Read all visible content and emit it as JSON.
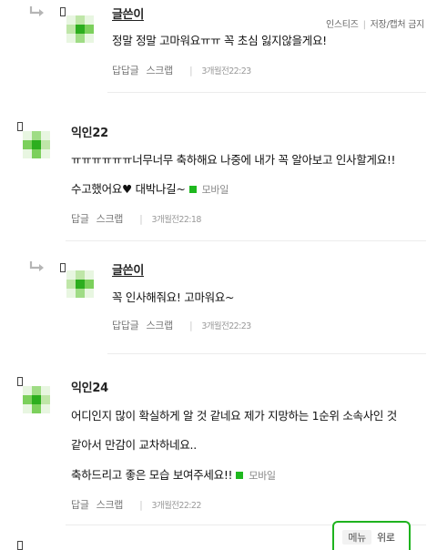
{
  "watermark": {
    "left": "인스티즈",
    "right": "저장/캡처 금지"
  },
  "comments": [
    {
      "nickname": "글쓴이",
      "lines": [
        "정말 정말 고마워요ㅠㅠ 꼭 초심 잃지않을게요!"
      ],
      "actions": [
        "답답글",
        "스크랩"
      ],
      "time": "3개월전22:23",
      "avatar_colors": [
        "#e8f6e1",
        "#bfe6a8",
        "#e8f6e1",
        "#bfe6a8",
        "#2cae1e",
        "#7cd05c",
        "#e8f6e1",
        "#9fdc85",
        "#e8f6e1"
      ]
    },
    {
      "nickname": "익인22",
      "lines": [
        "ㅠㅠㅠㅠㅠㅠ너무너무 축하해요 나중에 내가 꼭 알아보고 인사할게요!!",
        "수고했어요♥ 대박나길~"
      ],
      "mobile": "모바일",
      "actions": [
        "답글",
        "스크랩"
      ],
      "time": "3개월전22:18",
      "avatar_colors": [
        "#e8f6e1",
        "#9fdc85",
        "#e8f6e1",
        "#7cd05c",
        "#2cae1e",
        "#bfe6a8",
        "#e8f6e1",
        "#7cd05c",
        "#e8f6e1"
      ]
    },
    {
      "nickname": "글쓴이",
      "lines": [
        "꼭 인사해줘요! 고마워요~"
      ],
      "actions": [
        "답답글",
        "스크랩"
      ],
      "time": "3개월전22:23",
      "avatar_colors": [
        "#e8f6e1",
        "#bfe6a8",
        "#e8f6e1",
        "#bfe6a8",
        "#2cae1e",
        "#7cd05c",
        "#e8f6e1",
        "#9fdc85",
        "#e8f6e1"
      ]
    },
    {
      "nickname": "익인24",
      "lines": [
        "어디인지 많이 확실하게 알 것 같네요 제가 지망하는 1순위 소속사인 것",
        "같아서 만감이 교차하네요..",
        "축하드리고 좋은 모습 보여주세요!!"
      ],
      "mobile": "모바일",
      "actions": [
        "답글",
        "스크랩"
      ],
      "time": "3개월전22:22",
      "avatar_colors": [
        "#e8f6e1",
        "#9fdc85",
        "#e8f6e1",
        "#7cd05c",
        "#2cae1e",
        "#bfe6a8",
        "#e8f6e1",
        "#7cd05c",
        "#e8f6e1"
      ]
    }
  ],
  "float_nav": {
    "menu": "메뉴",
    "top": "위로"
  },
  "colors": {
    "mobile_mark": "#1fb81f",
    "nav_border": "#1eb31e"
  }
}
